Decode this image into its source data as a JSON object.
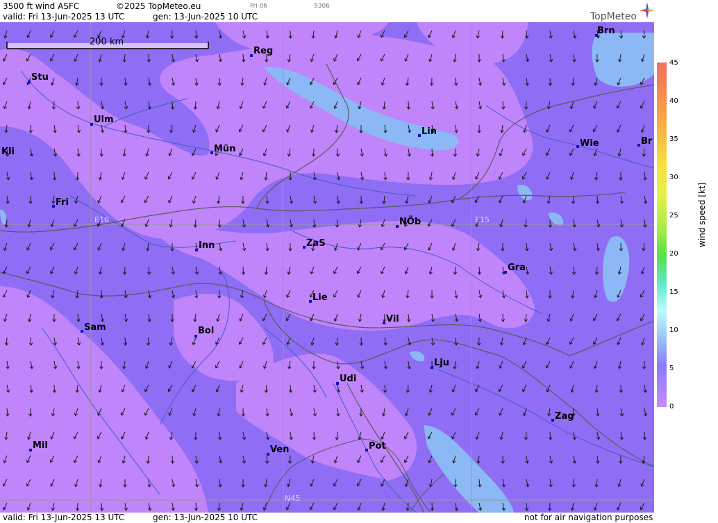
{
  "header": {
    "product": "3500 ft wind ASFC",
    "copyright": "©2025 TopMeteo.eu",
    "faint_day": "Fri 06",
    "faint_code": "9306",
    "valid": "valid:  Fri  13-Jun-2025  13 UTC",
    "generated": "gen: 13-Jun-2025 10 UTC",
    "logo": "TopMeteo"
  },
  "footer": {
    "valid": "valid:  Fri  13-Jun-2025  13 UTC",
    "generated": "gen: 13-Jun-2025 10 UTC",
    "disclaimer": "not for air navigation purposes"
  },
  "map": {
    "scale_label": "200 km",
    "coord_labels": [
      "E10",
      "E15",
      "N45"
    ],
    "cities": [
      "Brn",
      "Reg",
      "Stu",
      "Ulm",
      "Kli",
      "Mün",
      "Lin",
      "Wie",
      "Br",
      "Fri",
      "NÖb",
      "Inn",
      "ZaS",
      "Gra",
      "Lie",
      "Vil",
      "Sam",
      "Bol",
      "Lju",
      "Udi",
      "Zag",
      "Mil",
      "Ven",
      "Pot"
    ],
    "colors": {
      "lt5": "#c084fb",
      "r5_10": "#8f6df5",
      "r10_15": "#8cb8f5",
      "water": "#4060c0",
      "border": "#5a5a5a",
      "arrow": "#1a1a1a",
      "city_marker": "#1010c0"
    }
  },
  "legend": {
    "title": "wind  speed  [kt]",
    "ticks": [
      "45",
      "40",
      "35",
      "30",
      "25",
      "20",
      "15",
      "10",
      "5",
      "0"
    ],
    "colors": [
      "#f07060",
      "#f48c4c",
      "#f6b040",
      "#f8e040",
      "#e8f048",
      "#a8ec48",
      "#58e048",
      "#60e8c8",
      "#bcfcfc",
      "#9cc4f8",
      "#8a7af8",
      "#c68cfa"
    ]
  }
}
